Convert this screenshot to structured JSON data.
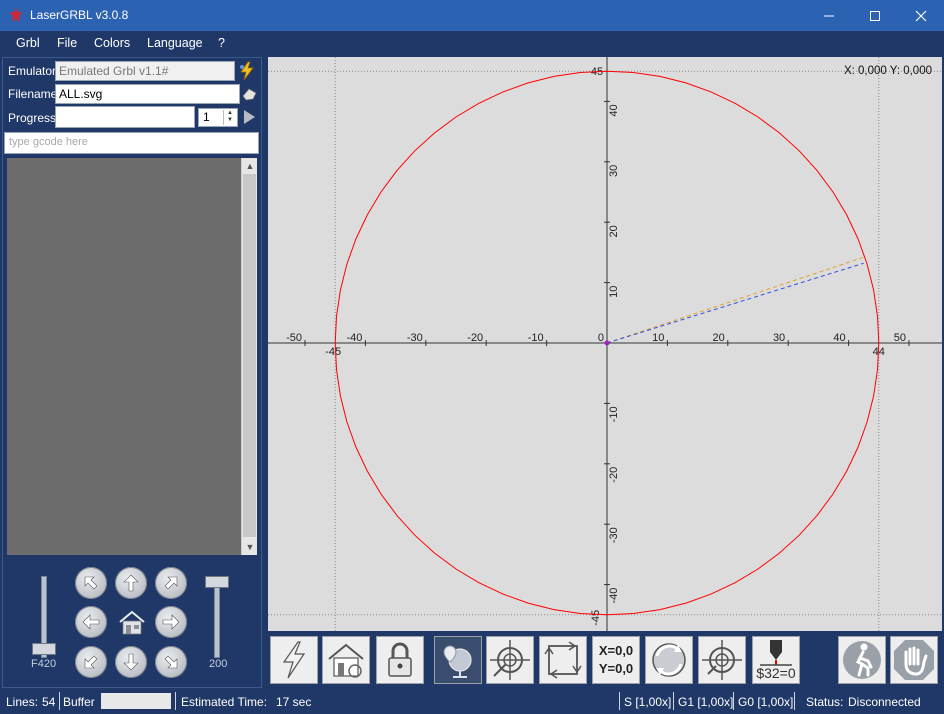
{
  "window": {
    "title": "LaserGRBL v3.0.8",
    "minimize_icon": "minimize-icon",
    "maximize_icon": "maximize-icon",
    "close_icon": "close-icon"
  },
  "menu": [
    "Grbl",
    "File",
    "Colors",
    "Language",
    "?"
  ],
  "left": {
    "emulator_label": "Emulator",
    "emulator_value": "Emulated Grbl v1.1#",
    "filename_label": "Filename",
    "filename_value": "ALL.svg",
    "progress_label": "Progress",
    "passes_value": "1",
    "gcode_placeholder": "type gcode here",
    "feed_label": "F420",
    "power_label": "200"
  },
  "canvas": {
    "cursor_readout": "X: 0,000 Y: 0,000",
    "x_ticks": [
      "-50",
      "-40",
      "-30",
      "-20",
      "-10",
      "0",
      "10",
      "20",
      "30",
      "40",
      "50"
    ],
    "y_ticks": [
      "40",
      "30",
      "20",
      "10",
      "-10",
      "-20",
      "-30",
      "-40"
    ],
    "bound_labels": {
      "left": "-45",
      "right": "44",
      "top": "45",
      "bottom": "-45"
    },
    "shape_color": "#ff0000",
    "circle_radius_mm": 45
  },
  "toolbar_icons": [
    "lightning-connect-icon",
    "homing-icon",
    "unlock-icon",
    "globe-pin-icon",
    "crosshair-center-icon",
    "frame-icon",
    "zero-xy-icon",
    "reset-cycle-icon",
    "crosshair-go-icon",
    "grbl-settings-icon",
    "walk-run-icon",
    "stop-hand-icon"
  ],
  "toolbar_text": {
    "zero_x": "X=0,0",
    "zero_y": "Y=0,0",
    "settings": "$32=0"
  },
  "status": {
    "lines_label": "Lines:",
    "lines_value": "54",
    "buffer_label": "Buffer",
    "estimated_label": "Estimated Time:",
    "estimated_value": "17 sec",
    "s_override": "S [1,00x]",
    "g1_override": "G1 [1,00x]",
    "g0_override": "G0 [1,00x]",
    "status_label": "Status:",
    "status_value": "Disconnected"
  }
}
